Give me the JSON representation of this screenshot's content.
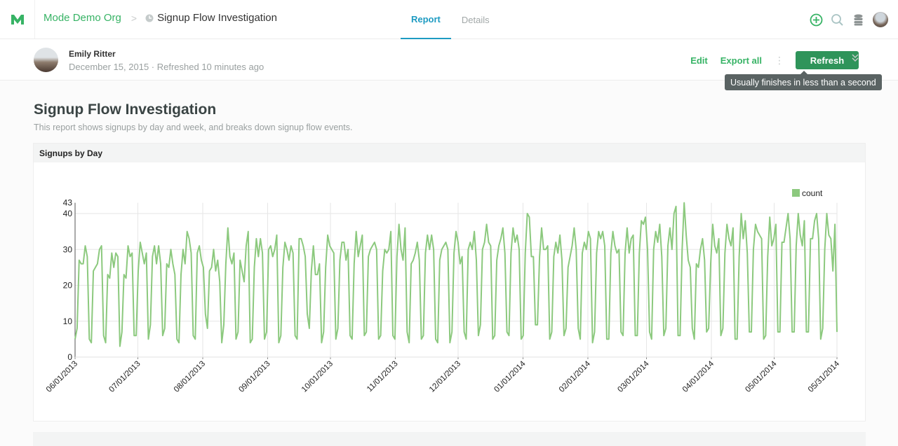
{
  "topbar": {
    "org": "Mode Demo Org",
    "separator": ">",
    "report_title": "Signup Flow Investigation",
    "tabs": [
      {
        "label": "Report",
        "active": true
      },
      {
        "label": "Details",
        "active": false
      }
    ],
    "icons": [
      "mode-logo-icon",
      "add-icon",
      "search-icon",
      "database-icon",
      "user-avatar"
    ]
  },
  "subbar": {
    "author": "Emily Ritter",
    "meta": "December 15, 2015 · Refreshed 10 minutes ago",
    "edit": "Edit",
    "export": "Export all",
    "more": "⋮",
    "refresh": "Refresh",
    "collapse": "⌄⌄",
    "tooltip": "Usually finishes in less than a second"
  },
  "report": {
    "title": "Signup Flow Investigation",
    "description": "This report shows signups by day and week, and breaks down signup flow events."
  },
  "colors": {
    "accent": "#37b365",
    "button": "#2f945a",
    "tab_active": "#1e9bc2",
    "series": "#8cc97e"
  },
  "chart_data": {
    "type": "line",
    "title": "Signups by Day",
    "xlabel": "",
    "ylabel": "",
    "ylim": [
      0,
      43
    ],
    "yticks": [
      0,
      10,
      20,
      30,
      40,
      43
    ],
    "x_start": "2013-06-01",
    "x_end": "2014-05-31",
    "xticks": [
      "06/01/2013",
      "07/01/2013",
      "08/01/2013",
      "09/01/2013",
      "10/01/2013",
      "11/01/2013",
      "12/01/2013",
      "01/01/2014",
      "02/01/2014",
      "03/01/2014",
      "04/01/2014",
      "05/01/2014",
      "05/31/2014"
    ],
    "xtick_days": [
      0,
      30,
      61,
      92,
      122,
      153,
      183,
      214,
      245,
      273,
      304,
      334,
      364
    ],
    "grid": true,
    "legend": "top-right",
    "series": [
      {
        "name": "count",
        "values": [
          5,
          8,
          27,
          26,
          26,
          31,
          28,
          5,
          4,
          24,
          25,
          26,
          30,
          31,
          6,
          4,
          23,
          22,
          29,
          25,
          29,
          28,
          3,
          7,
          23,
          22,
          31,
          28,
          29,
          6,
          6,
          24,
          32,
          29,
          26,
          29,
          5,
          9,
          28,
          31,
          26,
          31,
          26,
          6,
          8,
          26,
          25,
          30,
          26,
          23,
          5,
          4,
          23,
          30,
          26,
          35,
          33,
          29,
          6,
          5,
          29,
          31,
          27,
          25,
          12,
          8,
          24,
          25,
          30,
          24,
          27,
          21,
          4,
          9,
          26,
          36,
          28,
          26,
          29,
          5,
          7,
          27,
          24,
          21,
          31,
          35,
          4,
          5,
          25,
          33,
          28,
          33,
          29,
          5,
          7,
          30,
          31,
          28,
          30,
          34,
          4,
          6,
          25,
          32,
          30,
          27,
          31,
          29,
          6,
          5,
          33,
          33,
          31,
          28,
          12,
          8,
          24,
          31,
          23,
          23,
          26,
          4,
          7,
          25,
          34,
          31,
          30,
          29,
          5,
          8,
          27,
          32,
          32,
          27,
          30,
          6,
          5,
          26,
          35,
          28,
          31,
          34,
          6,
          7,
          28,
          30,
          31,
          32,
          30,
          5,
          6,
          24,
          30,
          29,
          30,
          35,
          6,
          5,
          28,
          37,
          30,
          27,
          36,
          7,
          4,
          26,
          27,
          29,
          32,
          27,
          5,
          6,
          29,
          34,
          30,
          34,
          30,
          5,
          4,
          27,
          30,
          31,
          32,
          30,
          4,
          7,
          29,
          35,
          32,
          26,
          28,
          7,
          5,
          30,
          32,
          30,
          35,
          27,
          6,
          9,
          30,
          32,
          37,
          32,
          31,
          5,
          6,
          27,
          31,
          33,
          36,
          29,
          7,
          6,
          29,
          36,
          32,
          34,
          30,
          5,
          6,
          29,
          40,
          39,
          28,
          28,
          9,
          9,
          28,
          36,
          30,
          30,
          31,
          5,
          7,
          28,
          32,
          29,
          34,
          27,
          6,
          8,
          25,
          28,
          31,
          36,
          30,
          8,
          5,
          29,
          32,
          30,
          35,
          33,
          4,
          7,
          29,
          35,
          33,
          35,
          31,
          5,
          5,
          29,
          35,
          31,
          29,
          30,
          7,
          6,
          29,
          36,
          29,
          33,
          34,
          6,
          6,
          29,
          38,
          37,
          39,
          30,
          7,
          5,
          30,
          35,
          32,
          37,
          28,
          6,
          8,
          31,
          36,
          30,
          40,
          42,
          6,
          6,
          30,
          43,
          34,
          27,
          25,
          8,
          5,
          26,
          25,
          30,
          33,
          27,
          7,
          8,
          26,
          37,
          31,
          29,
          33,
          6,
          8,
          29,
          37,
          33,
          31,
          36,
          5,
          5,
          28,
          40,
          33,
          38,
          29,
          7,
          7,
          30,
          37,
          35,
          34,
          33,
          5,
          6,
          28,
          39,
          31,
          33,
          37,
          7,
          7,
          32,
          32,
          36,
          40,
          33,
          7,
          7,
          31,
          40,
          34,
          31,
          38,
          7,
          7,
          33,
          33,
          38,
          40,
          33,
          5,
          8,
          30,
          40,
          34,
          33,
          24,
          37,
          7
        ]
      }
    ]
  }
}
